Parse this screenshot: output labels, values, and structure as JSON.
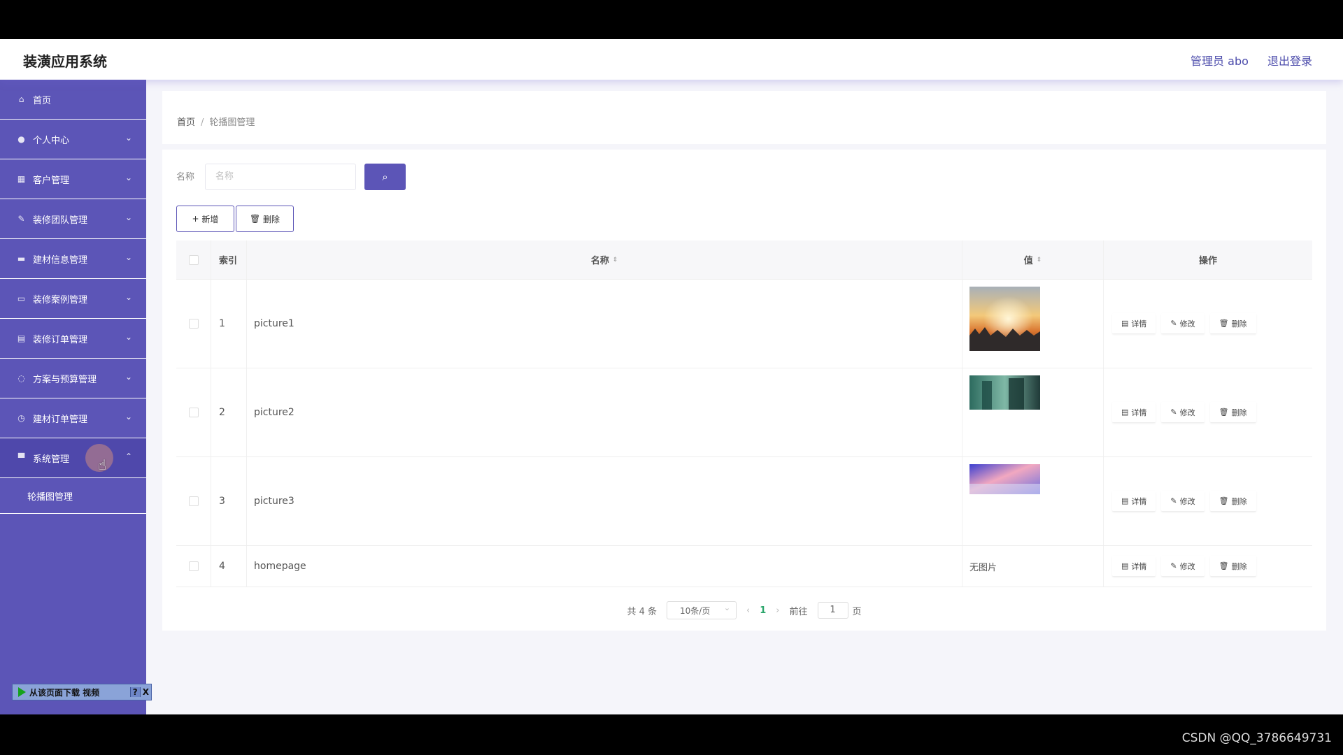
{
  "header": {
    "title": "装潢应用系统",
    "user": "管理员 abo",
    "logout": "退出登录"
  },
  "sidebar": {
    "items": [
      {
        "label": "首页",
        "icon": "home-icon",
        "has_chevron": false
      },
      {
        "label": "个人中心",
        "icon": "user-icon",
        "has_chevron": true
      },
      {
        "label": "客户管理",
        "icon": "grid-icon",
        "has_chevron": true
      },
      {
        "label": "装修团队管理",
        "icon": "tools-icon",
        "has_chevron": true
      },
      {
        "label": "建材信息管理",
        "icon": "box-icon",
        "has_chevron": true
      },
      {
        "label": "装修案例管理",
        "icon": "briefcase-icon",
        "has_chevron": true
      },
      {
        "label": "装修订单管理",
        "icon": "document-icon",
        "has_chevron": true
      },
      {
        "label": "方案与预算管理",
        "icon": "power-icon",
        "has_chevron": true
      },
      {
        "label": "建材订单管理",
        "icon": "clock-icon",
        "has_chevron": true
      },
      {
        "label": "系统管理",
        "icon": "monitor-icon",
        "has_chevron": true,
        "expanded": true
      }
    ],
    "sub_items": [
      {
        "label": "轮播图管理"
      }
    ]
  },
  "breadcrumb": {
    "home": "首页",
    "separator": "/",
    "current": "轮播图管理"
  },
  "search": {
    "label": "名称",
    "placeholder": "名称"
  },
  "toolbar": {
    "add_label": "新增",
    "delete_label": "删除"
  },
  "table": {
    "headers": {
      "index": "索引",
      "name": "名称",
      "value": "值",
      "ops": "操作"
    },
    "rows": [
      {
        "index": "1",
        "name": "picture1",
        "value_type": "image"
      },
      {
        "index": "2",
        "name": "picture2",
        "value_type": "image"
      },
      {
        "index": "3",
        "name": "picture3",
        "value_type": "image"
      },
      {
        "index": "4",
        "name": "homepage",
        "value_type": "text",
        "value": "无图片"
      }
    ],
    "ops": {
      "detail": "详情",
      "edit": "修改",
      "delete": "删除"
    }
  },
  "pagination": {
    "total": "共 4 条",
    "page_size": "10条/页",
    "current": "1",
    "goto_label": "前往",
    "goto_value": "1",
    "goto_suffix": "页"
  },
  "download_bar": {
    "label": "从该页面下载 视频",
    "help": "?",
    "close": "X"
  },
  "watermark": "CSDN @QQ_3786649731",
  "colors": {
    "accent": "#5c55b7",
    "accent_dark": "#4f48ab",
    "page_number": "#2aa56a"
  }
}
